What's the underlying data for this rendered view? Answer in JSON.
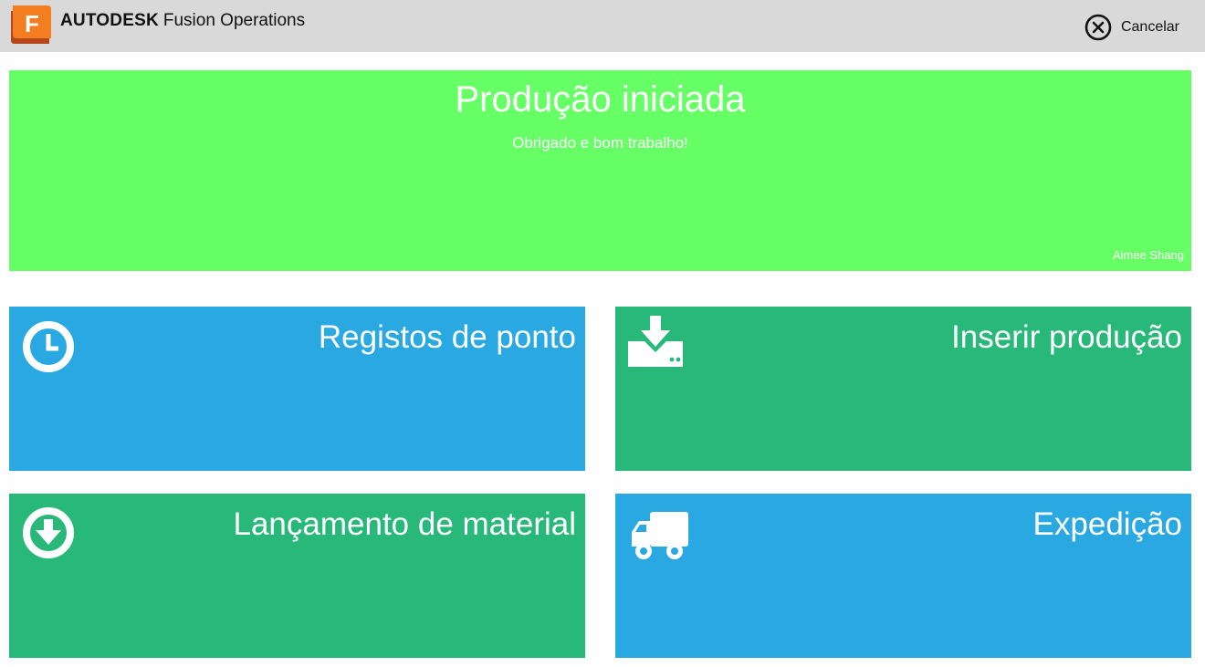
{
  "header": {
    "brand_bold": "AUTODESK",
    "brand_product": "Fusion Operations",
    "logo_letter": "F",
    "logo_icon": "fusion-logo-icon",
    "cancel_label": "Cancelar",
    "cancel_icon": "close-circle-icon"
  },
  "banner": {
    "title": "Produção iniciada",
    "subtitle": "Obrigado e bom trabalho!",
    "user": "Aimee Shang",
    "color": "#66ff66"
  },
  "tiles": [
    {
      "label": "Registos de ponto",
      "icon": "clock-icon",
      "color": "#29a8e2"
    },
    {
      "label": "Inserir produção",
      "icon": "download-tray-icon",
      "color": "#28b87a"
    },
    {
      "label": "Lançamento de material",
      "icon": "arrow-down-circle-icon",
      "color": "#28b87a"
    },
    {
      "label": "Expedição",
      "icon": "truck-icon",
      "color": "#29a8e2"
    }
  ]
}
